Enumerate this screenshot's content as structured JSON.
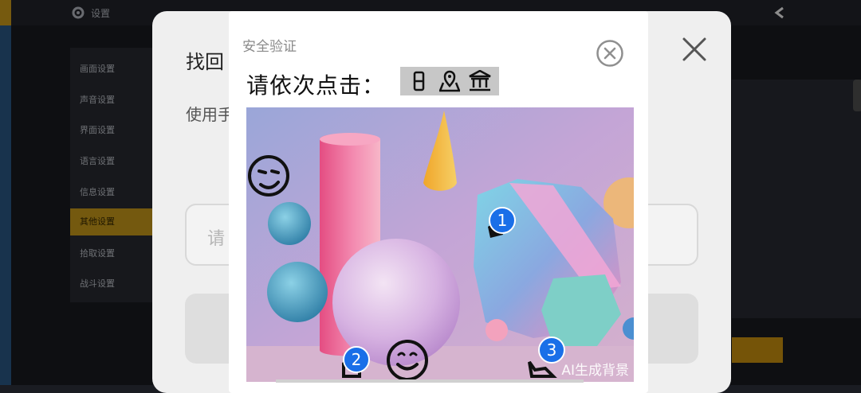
{
  "background": {
    "title": "设置",
    "sidebar": [
      "画面设置",
      "声音设置",
      "界面设置",
      "语言设置",
      "信息设置",
      "其他设置",
      "拾取设置",
      "战斗设置"
    ],
    "active_index": 5
  },
  "dialog": {
    "title": "找回",
    "subtitle": "使用手",
    "input_placeholder": "请"
  },
  "captcha": {
    "header": "安全验证",
    "instruction": "请依次点击：",
    "target_icons": [
      "locker-icon",
      "map-pin-icon",
      "temple-icon"
    ],
    "ai_label": "AI生成背景",
    "markers": [
      "1",
      "2",
      "3"
    ]
  }
}
